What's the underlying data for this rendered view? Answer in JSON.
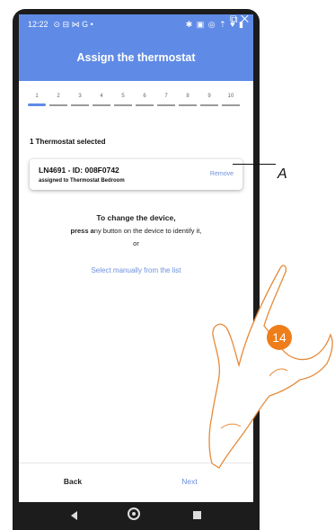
{
  "status_bar": {
    "time": "12:22",
    "left_icons": "⊙ ⊟ ⋈ G •",
    "right_icons": "✱ ▣ ◎ ⇡ ♥ ▮"
  },
  "header": {
    "title": "Assign the thermostat"
  },
  "steps": {
    "labels": [
      "1",
      "2",
      "3",
      "4",
      "5",
      "6",
      "7",
      "8",
      "9",
      "10"
    ],
    "active_index": 0
  },
  "selection": {
    "title": "1 Thermostat selected"
  },
  "card": {
    "device_line": "LN4691 - ID: 008F0742",
    "assigned_line": "assigned to Thermostat Bedroom",
    "remove_label": "Remove"
  },
  "instructions": {
    "line1": "To change the device,",
    "line2_bold": "press a",
    "line2_rest": "ny button on the device to identify it,",
    "line3": "or"
  },
  "manual_link": "Select manually from the list",
  "footer": {
    "back_label": "Back",
    "next_label": "Next"
  },
  "annotations": {
    "callout_label": "A",
    "step_badge": "14",
    "badge_color": "#ee7d1a"
  },
  "colors": {
    "accent": "#5f8be6",
    "link": "#6d90dc"
  }
}
